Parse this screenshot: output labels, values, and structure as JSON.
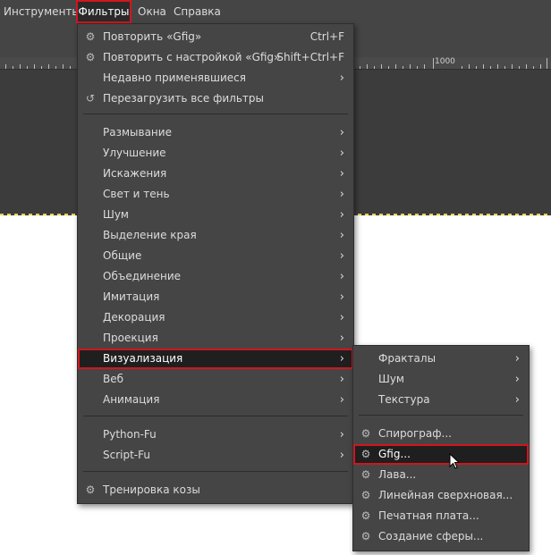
{
  "menubar": {
    "items": [
      "Инструменты",
      "Фильтры",
      "Окна",
      "Справка"
    ]
  },
  "ruler": {
    "label": "1000"
  },
  "filters_menu": {
    "repeat": {
      "label": "Повторить «Gfig»",
      "shortcut": "Ctrl+F"
    },
    "reshow": {
      "label": "Повторить с настройкой «Gfig»",
      "shortcut": "Shift+Ctrl+F"
    },
    "recent": {
      "label": "Недавно применявшиеся"
    },
    "reset": {
      "label": "Перезагрузить все фильтры"
    },
    "categories": [
      "Размывание",
      "Улучшение",
      "Искажения",
      "Свет и тень",
      "Шум",
      "Выделение края",
      "Общие",
      "Объединение",
      "Имитация",
      "Декорация",
      "Проекция",
      "Визуализация",
      "Веб",
      "Анимация"
    ],
    "scripts": [
      "Python-Fu",
      "Script-Fu"
    ],
    "goat": {
      "label": "Тренировка козы"
    }
  },
  "render_submenu": {
    "groups": [
      "Фракталы",
      "Шум",
      "Текстура"
    ],
    "items": [
      "Спирограф...",
      "Gfig...",
      "Лава...",
      "Линейная сверхновая...",
      "Печатная плата...",
      "Создание сферы..."
    ]
  }
}
